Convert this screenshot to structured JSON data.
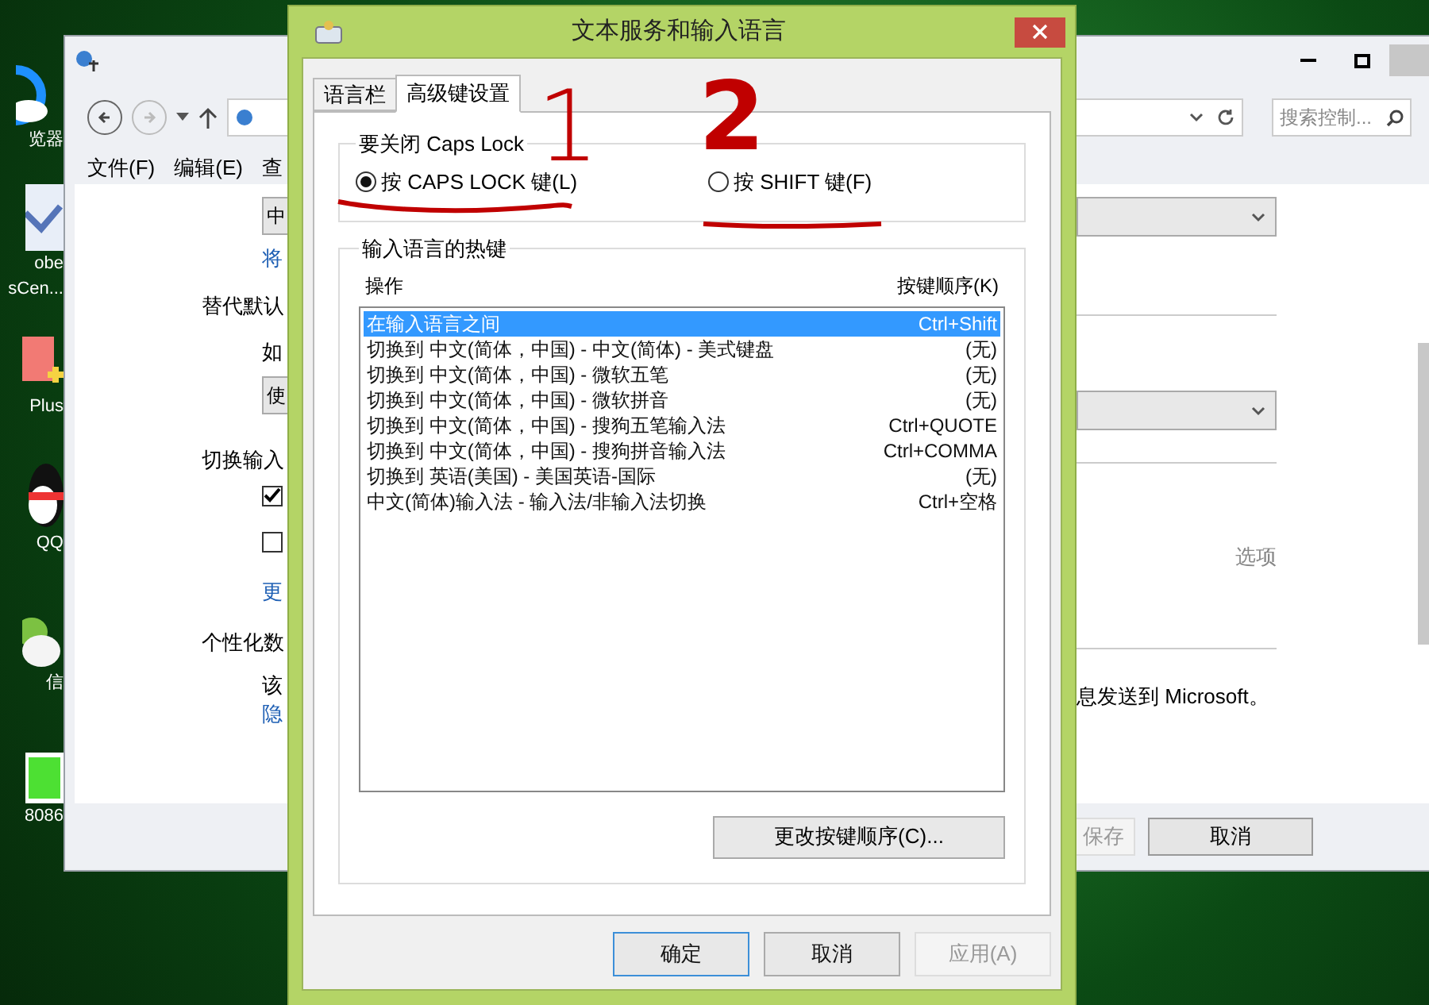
{
  "desktop": {
    "icons": [
      {
        "label": "览器"
      },
      {
        "label": "obe"
      },
      {
        "label": "sCen..."
      },
      {
        "label": "Plus"
      },
      {
        "label": "QQ"
      },
      {
        "label": "信"
      },
      {
        "label": "8086"
      }
    ]
  },
  "background_window": {
    "search": {
      "placeholder": "搜索控制..."
    },
    "menu": [
      "文件(F)",
      "编辑(E)",
      "查"
    ],
    "left_items": [
      {
        "kind": "dropdown",
        "text": "中"
      },
      {
        "kind": "link",
        "text": "将"
      },
      {
        "kind": "heading",
        "text": "替代默认"
      },
      {
        "kind": "text",
        "text": "如"
      },
      {
        "kind": "dropdown",
        "text": "使"
      },
      {
        "kind": "heading",
        "text": "切换输入"
      },
      {
        "kind": "checkbox",
        "checked": true
      },
      {
        "kind": "checkbox",
        "checked": false
      },
      {
        "kind": "link",
        "text": "更"
      },
      {
        "kind": "heading",
        "text": "个性化数"
      },
      {
        "kind": "text",
        "text": "该"
      },
      {
        "kind": "link",
        "text": "隐"
      }
    ],
    "right_items": [
      {
        "kind": "dropdown"
      },
      {
        "kind": "rule"
      },
      {
        "kind": "dropdown"
      },
      {
        "kind": "rule"
      },
      {
        "kind": "link",
        "text": "选项"
      },
      {
        "kind": "rule"
      },
      {
        "kind": "text",
        "text": "息发送到 Microsoft。"
      }
    ],
    "buttons": [
      {
        "label": "保存",
        "disabled": true
      },
      {
        "label": "取消",
        "disabled": false
      }
    ]
  },
  "dialog": {
    "title": "文本服务和输入语言",
    "tabs": [
      {
        "label": "语言栏",
        "selected": false
      },
      {
        "label": "高级键设置",
        "selected": true
      }
    ],
    "caps_lock_group": {
      "title": "要关闭 Caps Lock",
      "options": [
        {
          "label": "按 CAPS LOCK 键(L)",
          "selected": true
        },
        {
          "label": "按 SHIFT 键(F)",
          "selected": false
        }
      ]
    },
    "hotkeys_group": {
      "title": "输入语言的热键",
      "columns": [
        "操作",
        "按键顺序(K)"
      ],
      "rows": [
        {
          "action": "在输入语言之间",
          "keys": "Ctrl+Shift",
          "selected": true
        },
        {
          "action": "切换到 中文(简体，中国) - 中文(简体) - 美式键盘",
          "keys": "(无)",
          "selected": false
        },
        {
          "action": "切换到 中文(简体，中国) - 微软五笔",
          "keys": "(无)",
          "selected": false
        },
        {
          "action": "切换到 中文(简体，中国) - 微软拼音",
          "keys": "(无)",
          "selected": false
        },
        {
          "action": "切换到 中文(简体，中国) - 搜狗五笔输入法",
          "keys": "Ctrl+QUOTE",
          "selected": false
        },
        {
          "action": "切换到 中文(简体，中国) - 搜狗拼音输入法",
          "keys": "Ctrl+COMMA",
          "selected": false
        },
        {
          "action": "切换到 英语(美国) - 美国英语-国际",
          "keys": "(无)",
          "selected": false
        },
        {
          "action": "中文(简体)输入法 - 输入法/非输入法切换",
          "keys": "Ctrl+空格",
          "selected": false
        }
      ],
      "change_button": "更改按键顺序(C)..."
    },
    "buttons": [
      {
        "label": "确定",
        "default": true,
        "disabled": false
      },
      {
        "label": "取消",
        "default": false,
        "disabled": false
      },
      {
        "label": "应用(A)",
        "default": false,
        "disabled": true
      }
    ]
  },
  "annotations": [
    {
      "text": "1"
    },
    {
      "text": "2"
    }
  ]
}
